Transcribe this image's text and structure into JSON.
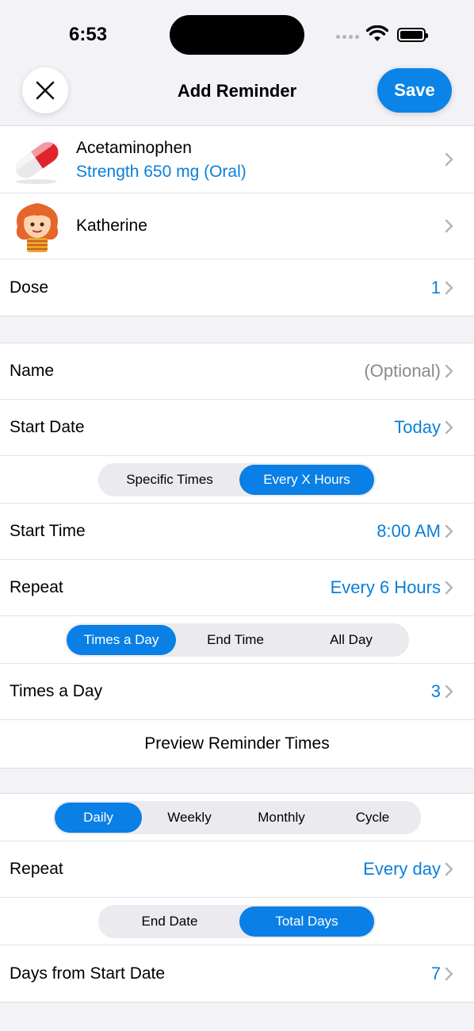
{
  "status": {
    "time": "6:53"
  },
  "nav": {
    "title": "Add Reminder",
    "save_label": "Save"
  },
  "medication": {
    "name": "Acetaminophen",
    "strength": "Strength 650 mg (Oral)"
  },
  "person": {
    "name": "Katherine"
  },
  "dose": {
    "label": "Dose",
    "value": "1"
  },
  "name_field": {
    "label": "Name",
    "value": "(Optional)"
  },
  "start_date": {
    "label": "Start Date",
    "value": "Today"
  },
  "time_mode": {
    "options": [
      "Specific Times",
      "Every X Hours"
    ],
    "selected": "Every X Hours"
  },
  "start_time": {
    "label": "Start Time",
    "value": "8:00 AM"
  },
  "repeat_hours": {
    "label": "Repeat",
    "value": "Every 6 Hours"
  },
  "limit_mode": {
    "options": [
      "Times a Day",
      "End Time",
      "All Day"
    ],
    "selected": "Times a Day"
  },
  "times_a_day": {
    "label": "Times a Day",
    "value": "3"
  },
  "preview": {
    "label": "Preview Reminder Times"
  },
  "frequency": {
    "options": [
      "Daily",
      "Weekly",
      "Monthly",
      "Cycle"
    ],
    "selected": "Daily"
  },
  "repeat_days": {
    "label": "Repeat",
    "value": "Every day"
  },
  "duration_mode": {
    "options": [
      "End Date",
      "Total Days"
    ],
    "selected": "Total Days"
  },
  "days_from_start": {
    "label": "Days from Start Date",
    "value": "7"
  },
  "colors": {
    "accent": "#0a84e8",
    "value_text": "#0a7fd9",
    "background": "#f2f2f7"
  }
}
